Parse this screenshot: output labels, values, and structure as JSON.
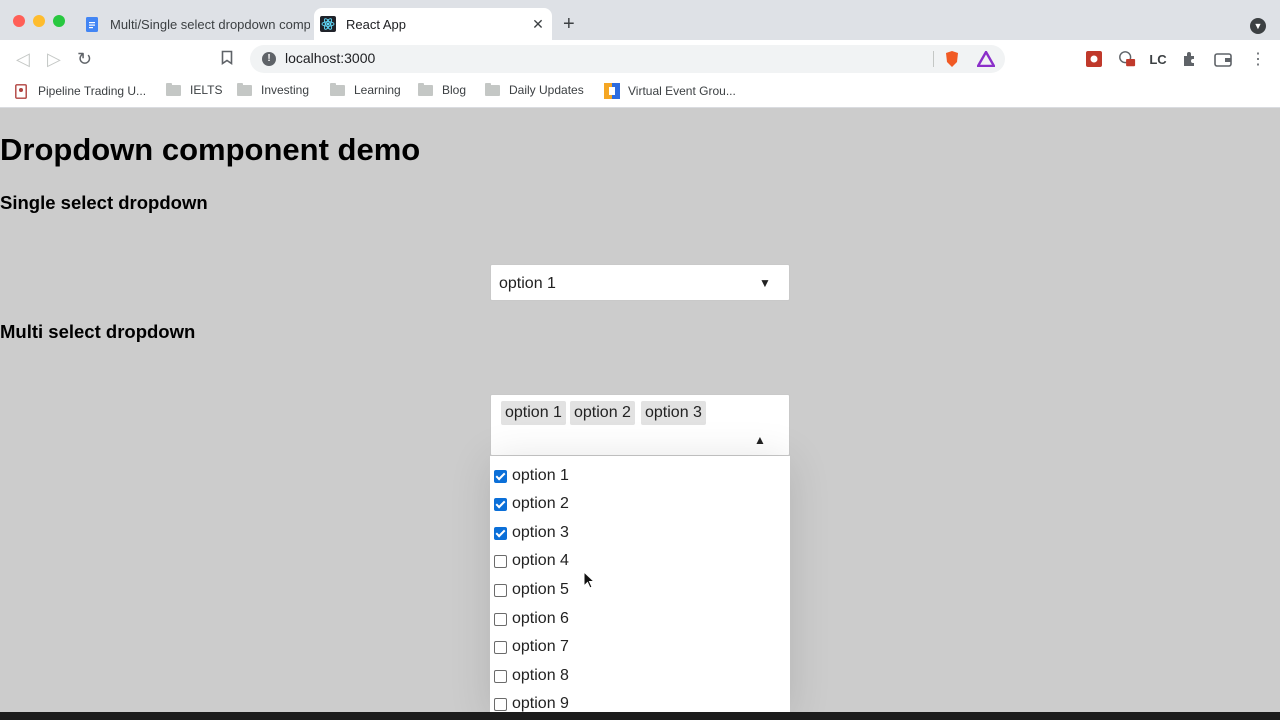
{
  "browser": {
    "tabs": [
      {
        "title": "Multi/Single select dropdown comp",
        "active": false
      },
      {
        "title": "React App",
        "active": true
      }
    ],
    "url": "localhost:3000",
    "bookmarks": [
      {
        "label": "Pipeline Trading U...",
        "icon": "pipeline-favicon-icon"
      },
      {
        "label": "IELTS",
        "icon": "folder-icon"
      },
      {
        "label": "Investing",
        "icon": "folder-icon"
      },
      {
        "label": "Learning",
        "icon": "folder-icon"
      },
      {
        "label": "Blog",
        "icon": "folder-icon"
      },
      {
        "label": "Daily Updates",
        "icon": "folder-icon"
      },
      {
        "label": "Virtual Event Grou...",
        "icon": "virtual-event-favicon-icon"
      }
    ],
    "extension_text": "LC"
  },
  "page": {
    "title": "Dropdown component demo",
    "single_heading": "Single select dropdown",
    "multi_heading": "Multi select dropdown",
    "single_select": {
      "value": "option 1",
      "arrow": "▼"
    },
    "multi_select": {
      "chips": [
        "option 1",
        "option 2",
        "option 3"
      ],
      "arrow": "▲",
      "options": [
        {
          "label": "option 1",
          "checked": true
        },
        {
          "label": "option 2",
          "checked": true
        },
        {
          "label": "option 3",
          "checked": true
        },
        {
          "label": "option 4",
          "checked": false
        },
        {
          "label": "option 5",
          "checked": false
        },
        {
          "label": "option 6",
          "checked": false
        },
        {
          "label": "option 7",
          "checked": false
        },
        {
          "label": "option 8",
          "checked": false
        },
        {
          "label": "option 9",
          "checked": false
        }
      ]
    }
  },
  "colors": {
    "page_background": "#cccccc",
    "checkbox_checked": "#0b6fd8",
    "chip_background": "#e2e2e2"
  }
}
